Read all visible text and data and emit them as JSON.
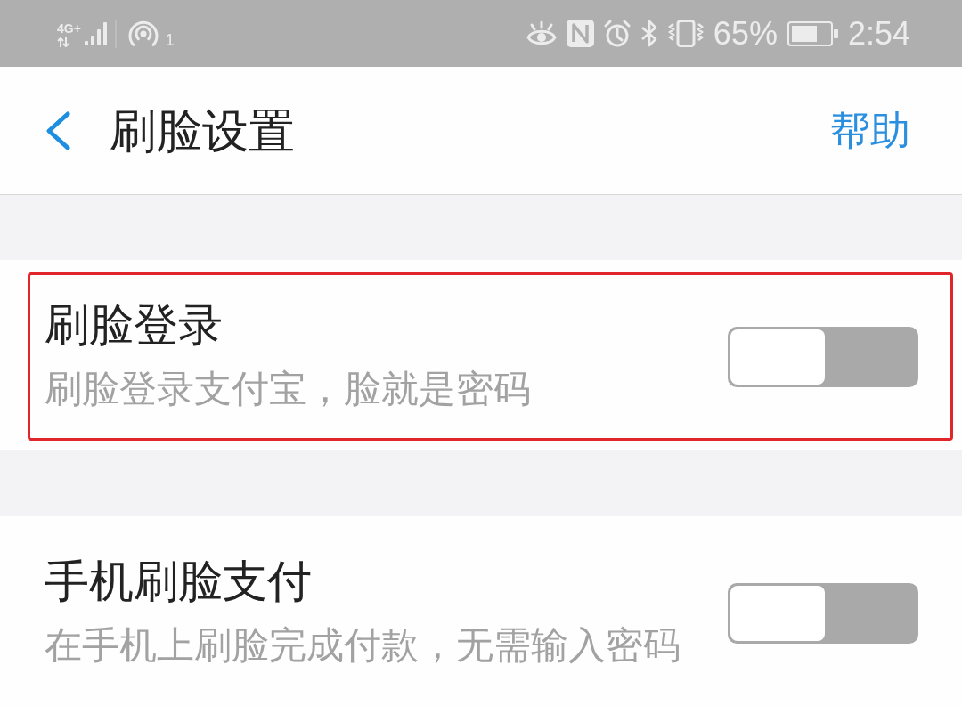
{
  "status_bar": {
    "network_type": "4G+",
    "hotspot_count": "1",
    "battery": "65%",
    "time": "2:54"
  },
  "nav_bar": {
    "title": "刷脸设置",
    "action": "帮助"
  },
  "settings": [
    {
      "title": "刷脸登录",
      "subtitle": "刷脸登录支付宝，脸就是密码",
      "on": false,
      "highlighted": true
    },
    {
      "title": "手机刷脸支付",
      "subtitle": "在手机上刷脸完成付款，无需输入密码",
      "on": false,
      "highlighted": false
    }
  ]
}
